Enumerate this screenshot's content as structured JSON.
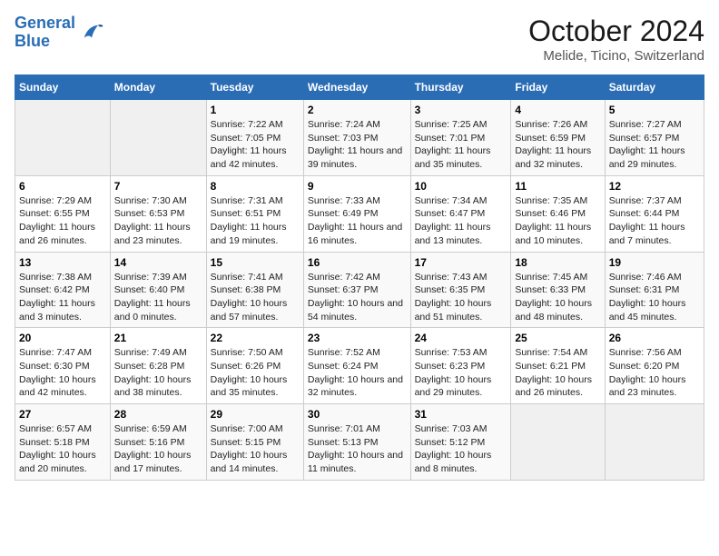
{
  "header": {
    "logo_line1": "General",
    "logo_line2": "Blue",
    "title": "October 2024",
    "subtitle": "Melide, Ticino, Switzerland"
  },
  "weekdays": [
    "Sunday",
    "Monday",
    "Tuesday",
    "Wednesday",
    "Thursday",
    "Friday",
    "Saturday"
  ],
  "weeks": [
    [
      {
        "day": "",
        "empty": true
      },
      {
        "day": "",
        "empty": true
      },
      {
        "day": "1",
        "sunrise": "Sunrise: 7:22 AM",
        "sunset": "Sunset: 7:05 PM",
        "daylight": "Daylight: 11 hours and 42 minutes."
      },
      {
        "day": "2",
        "sunrise": "Sunrise: 7:24 AM",
        "sunset": "Sunset: 7:03 PM",
        "daylight": "Daylight: 11 hours and 39 minutes."
      },
      {
        "day": "3",
        "sunrise": "Sunrise: 7:25 AM",
        "sunset": "Sunset: 7:01 PM",
        "daylight": "Daylight: 11 hours and 35 minutes."
      },
      {
        "day": "4",
        "sunrise": "Sunrise: 7:26 AM",
        "sunset": "Sunset: 6:59 PM",
        "daylight": "Daylight: 11 hours and 32 minutes."
      },
      {
        "day": "5",
        "sunrise": "Sunrise: 7:27 AM",
        "sunset": "Sunset: 6:57 PM",
        "daylight": "Daylight: 11 hours and 29 minutes."
      }
    ],
    [
      {
        "day": "6",
        "sunrise": "Sunrise: 7:29 AM",
        "sunset": "Sunset: 6:55 PM",
        "daylight": "Daylight: 11 hours and 26 minutes."
      },
      {
        "day": "7",
        "sunrise": "Sunrise: 7:30 AM",
        "sunset": "Sunset: 6:53 PM",
        "daylight": "Daylight: 11 hours and 23 minutes."
      },
      {
        "day": "8",
        "sunrise": "Sunrise: 7:31 AM",
        "sunset": "Sunset: 6:51 PM",
        "daylight": "Daylight: 11 hours and 19 minutes."
      },
      {
        "day": "9",
        "sunrise": "Sunrise: 7:33 AM",
        "sunset": "Sunset: 6:49 PM",
        "daylight": "Daylight: 11 hours and 16 minutes."
      },
      {
        "day": "10",
        "sunrise": "Sunrise: 7:34 AM",
        "sunset": "Sunset: 6:47 PM",
        "daylight": "Daylight: 11 hours and 13 minutes."
      },
      {
        "day": "11",
        "sunrise": "Sunrise: 7:35 AM",
        "sunset": "Sunset: 6:46 PM",
        "daylight": "Daylight: 11 hours and 10 minutes."
      },
      {
        "day": "12",
        "sunrise": "Sunrise: 7:37 AM",
        "sunset": "Sunset: 6:44 PM",
        "daylight": "Daylight: 11 hours and 7 minutes."
      }
    ],
    [
      {
        "day": "13",
        "sunrise": "Sunrise: 7:38 AM",
        "sunset": "Sunset: 6:42 PM",
        "daylight": "Daylight: 11 hours and 3 minutes."
      },
      {
        "day": "14",
        "sunrise": "Sunrise: 7:39 AM",
        "sunset": "Sunset: 6:40 PM",
        "daylight": "Daylight: 11 hours and 0 minutes."
      },
      {
        "day": "15",
        "sunrise": "Sunrise: 7:41 AM",
        "sunset": "Sunset: 6:38 PM",
        "daylight": "Daylight: 10 hours and 57 minutes."
      },
      {
        "day": "16",
        "sunrise": "Sunrise: 7:42 AM",
        "sunset": "Sunset: 6:37 PM",
        "daylight": "Daylight: 10 hours and 54 minutes."
      },
      {
        "day": "17",
        "sunrise": "Sunrise: 7:43 AM",
        "sunset": "Sunset: 6:35 PM",
        "daylight": "Daylight: 10 hours and 51 minutes."
      },
      {
        "day": "18",
        "sunrise": "Sunrise: 7:45 AM",
        "sunset": "Sunset: 6:33 PM",
        "daylight": "Daylight: 10 hours and 48 minutes."
      },
      {
        "day": "19",
        "sunrise": "Sunrise: 7:46 AM",
        "sunset": "Sunset: 6:31 PM",
        "daylight": "Daylight: 10 hours and 45 minutes."
      }
    ],
    [
      {
        "day": "20",
        "sunrise": "Sunrise: 7:47 AM",
        "sunset": "Sunset: 6:30 PM",
        "daylight": "Daylight: 10 hours and 42 minutes."
      },
      {
        "day": "21",
        "sunrise": "Sunrise: 7:49 AM",
        "sunset": "Sunset: 6:28 PM",
        "daylight": "Daylight: 10 hours and 38 minutes."
      },
      {
        "day": "22",
        "sunrise": "Sunrise: 7:50 AM",
        "sunset": "Sunset: 6:26 PM",
        "daylight": "Daylight: 10 hours and 35 minutes."
      },
      {
        "day": "23",
        "sunrise": "Sunrise: 7:52 AM",
        "sunset": "Sunset: 6:24 PM",
        "daylight": "Daylight: 10 hours and 32 minutes."
      },
      {
        "day": "24",
        "sunrise": "Sunrise: 7:53 AM",
        "sunset": "Sunset: 6:23 PM",
        "daylight": "Daylight: 10 hours and 29 minutes."
      },
      {
        "day": "25",
        "sunrise": "Sunrise: 7:54 AM",
        "sunset": "Sunset: 6:21 PM",
        "daylight": "Daylight: 10 hours and 26 minutes."
      },
      {
        "day": "26",
        "sunrise": "Sunrise: 7:56 AM",
        "sunset": "Sunset: 6:20 PM",
        "daylight": "Daylight: 10 hours and 23 minutes."
      }
    ],
    [
      {
        "day": "27",
        "sunrise": "Sunrise: 6:57 AM",
        "sunset": "Sunset: 5:18 PM",
        "daylight": "Daylight: 10 hours and 20 minutes."
      },
      {
        "day": "28",
        "sunrise": "Sunrise: 6:59 AM",
        "sunset": "Sunset: 5:16 PM",
        "daylight": "Daylight: 10 hours and 17 minutes."
      },
      {
        "day": "29",
        "sunrise": "Sunrise: 7:00 AM",
        "sunset": "Sunset: 5:15 PM",
        "daylight": "Daylight: 10 hours and 14 minutes."
      },
      {
        "day": "30",
        "sunrise": "Sunrise: 7:01 AM",
        "sunset": "Sunset: 5:13 PM",
        "daylight": "Daylight: 10 hours and 11 minutes."
      },
      {
        "day": "31",
        "sunrise": "Sunrise: 7:03 AM",
        "sunset": "Sunset: 5:12 PM",
        "daylight": "Daylight: 10 hours and 8 minutes."
      },
      {
        "day": "",
        "empty": true
      },
      {
        "day": "",
        "empty": true
      }
    ]
  ]
}
